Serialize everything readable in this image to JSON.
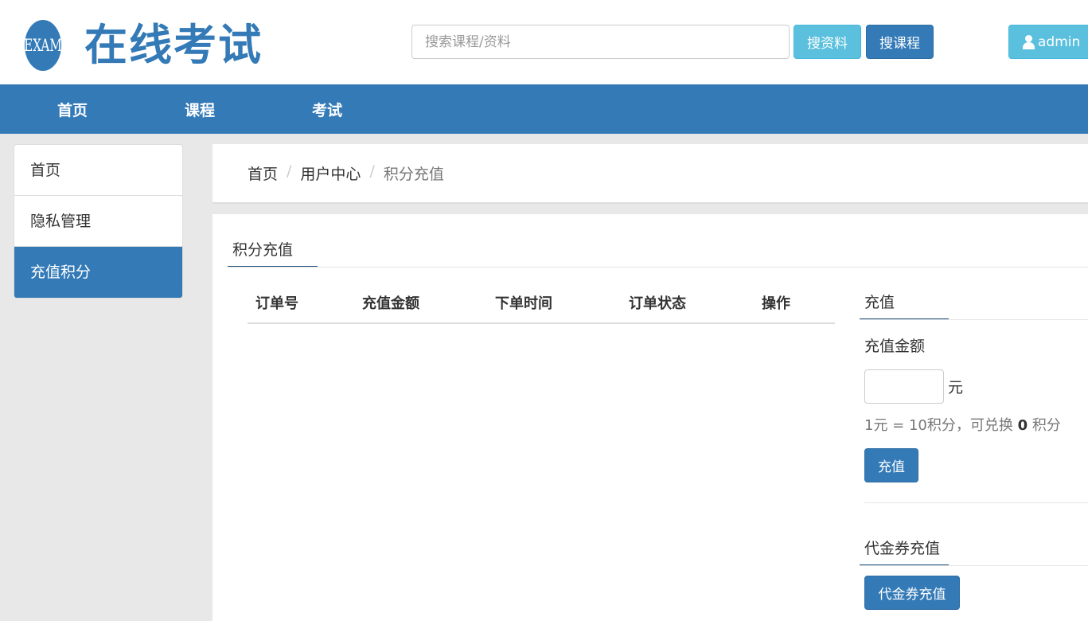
{
  "header": {
    "logo_text": "EXAM",
    "site_title": "在线考试",
    "search_placeholder": "搜索课程/资料",
    "search_value": "",
    "btn_search_material": "搜资料",
    "btn_search_course": "搜课程",
    "user_name": "admin",
    "colors": {
      "primary": "#337ab7",
      "info": "#5bc0de"
    }
  },
  "nav": {
    "items": [
      "首页",
      "课程",
      "考试"
    ]
  },
  "sidebar": {
    "items": [
      "首页",
      "隐私管理",
      "充值积分"
    ],
    "active_index": 2
  },
  "breadcrumb": {
    "items": [
      "首页",
      "用户中心",
      "积分充值"
    ],
    "separator": "/"
  },
  "main": {
    "tab_label": "积分充值",
    "table": {
      "columns": [
        "订单号",
        "充值金额",
        "下单时间",
        "订单状态",
        "操作"
      ],
      "rows": []
    },
    "recharge": {
      "title": "充值",
      "amount_label": "充值金额",
      "amount_value": "",
      "unit": "元",
      "rate_prefix": "1元 = 10积分，可兑换 ",
      "rate_points": "0",
      "rate_suffix": " 积分",
      "submit_label": "充值"
    },
    "voucher": {
      "title": "代金券充值",
      "button_label": "代金券充值"
    }
  }
}
